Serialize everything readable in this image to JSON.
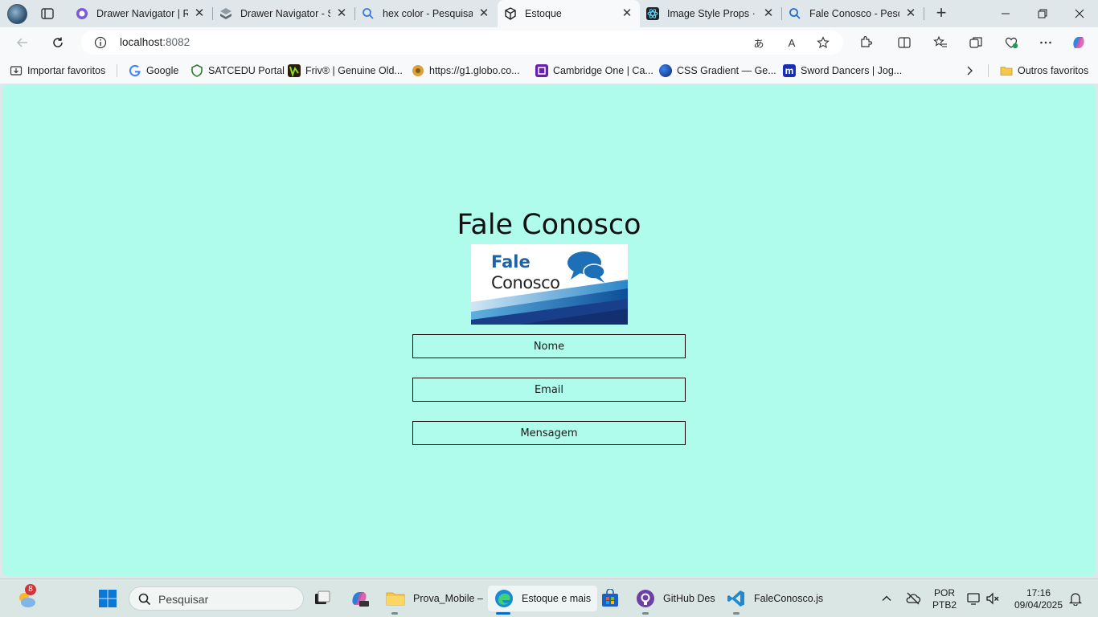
{
  "browser": {
    "tabs": [
      {
        "title": "Drawer Navigator | Re",
        "icon": "react-navigation-icon",
        "active": false
      },
      {
        "title": "Drawer Navigator - Sr",
        "icon": "snack-icon",
        "active": false
      },
      {
        "title": "hex color - Pesquisar",
        "icon": "search-icon",
        "active": false
      },
      {
        "title": "Estoque",
        "icon": "expo-icon",
        "active": true
      },
      {
        "title": "Image Style Props · Re",
        "icon": "react-icon",
        "active": false
      },
      {
        "title": "Fale Conosco - Pesqui",
        "icon": "search-icon",
        "active": false
      }
    ],
    "url_host": "localhost",
    "url_port": ":8082",
    "bookmarks": [
      {
        "label": "Importar favoritos",
        "icon": "import-icon"
      },
      {
        "label": "Google",
        "icon": "google-icon"
      },
      {
        "label": "SATCEDU Portal",
        "icon": "shield-icon"
      },
      {
        "label": "Friv® | Genuine Old...",
        "icon": "friv-icon"
      },
      {
        "label": "https://g1.globo.co...",
        "icon": "globo-icon"
      },
      {
        "label": "Cambridge One | Ca...",
        "icon": "cambridge-icon"
      },
      {
        "label": "CSS Gradient — Ge...",
        "icon": "gradient-icon"
      },
      {
        "label": "Sword Dancers | Jog...",
        "icon": "m-icon"
      }
    ],
    "other_favorites": "Outros favoritos",
    "colors": {
      "chrome": "#dfe7ea",
      "toolbar": "#f7f9fa",
      "page_bg": "#b0fcec"
    }
  },
  "page": {
    "title": "Fale Conosco",
    "logo": {
      "line1": "Fale",
      "line2": "Conosco"
    },
    "fields": {
      "name_placeholder": "Nome",
      "email_placeholder": "Email",
      "message_placeholder": "Mensagem"
    }
  },
  "taskbar": {
    "weather_badge": "8",
    "search_placeholder": "Pesquisar",
    "apps": [
      {
        "label": "Prova_Mobile –",
        "icon": "folder-icon"
      },
      {
        "label": "Estoque e mais",
        "icon": "edge-icon"
      },
      {
        "label": "GitHub Des",
        "icon": "github-icon"
      },
      {
        "label": "FaleConosco.js",
        "icon": "vscode-icon"
      }
    ],
    "lang_line1": "POR",
    "lang_line2": "PTB2",
    "time": "17:16",
    "date": "09/04/2025"
  }
}
